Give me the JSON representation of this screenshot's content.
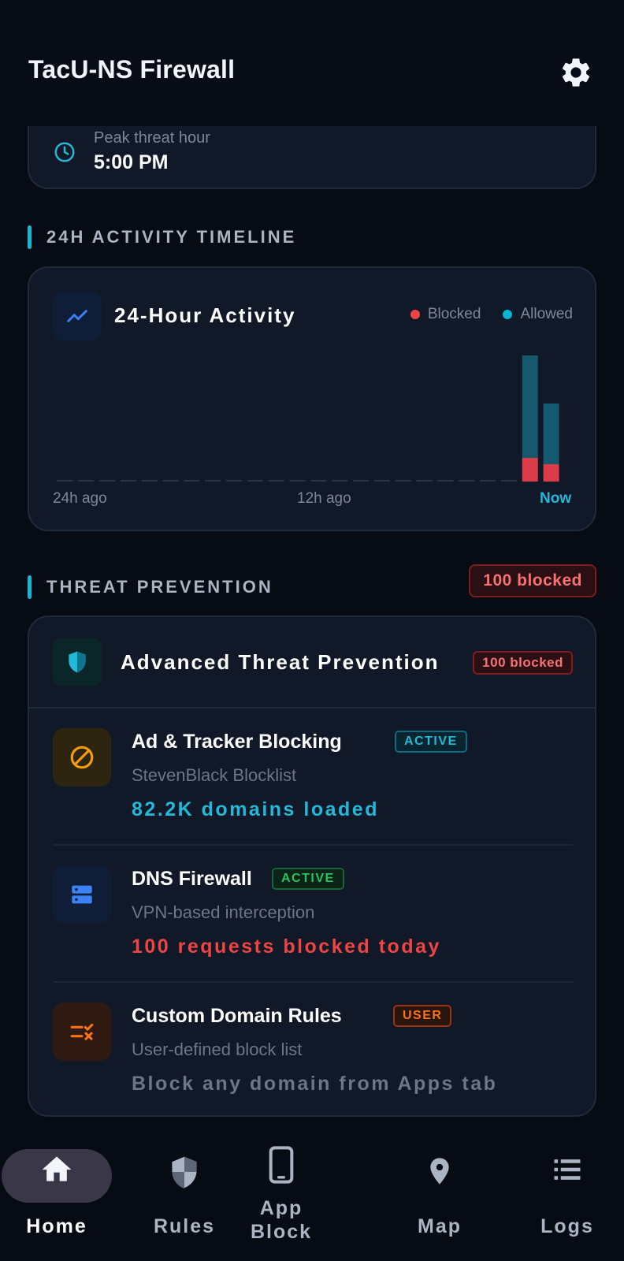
{
  "app": {
    "title": "TacU-NS Firewall"
  },
  "peak": {
    "label": "Peak threat hour",
    "value": "5:00 PM"
  },
  "timeline_section": {
    "title": "24H ACTIVITY TIMELINE"
  },
  "activity_chart": {
    "title": "24-Hour Activity",
    "legend": {
      "blocked": "Blocked",
      "allowed": "Allowed"
    },
    "x_labels": {
      "start": "24h ago",
      "mid": "12h ago",
      "end": "Now"
    },
    "colors": {
      "blocked": "#dc3c48",
      "allowed": "#15596e",
      "dash": "#2a3546"
    }
  },
  "chart_data": {
    "type": "bar",
    "stacked": true,
    "categories": [
      "-23h",
      "-22h",
      "-21h",
      "-20h",
      "-19h",
      "-18h",
      "-17h",
      "-16h",
      "-15h",
      "-14h",
      "-13h",
      "-12h",
      "-11h",
      "-10h",
      "-9h",
      "-8h",
      "-7h",
      "-6h",
      "-5h",
      "-4h",
      "-3h",
      "-2h",
      "-1h",
      "Now"
    ],
    "series": [
      {
        "name": "Blocked",
        "values": [
          0,
          0,
          0,
          0,
          0,
          0,
          0,
          0,
          0,
          0,
          0,
          0,
          0,
          0,
          0,
          0,
          0,
          0,
          0,
          0,
          0,
          0,
          30,
          22
        ]
      },
      {
        "name": "Allowed",
        "values": [
          0,
          0,
          0,
          0,
          0,
          0,
          0,
          0,
          0,
          0,
          0,
          0,
          0,
          0,
          0,
          0,
          0,
          0,
          0,
          0,
          0,
          0,
          130,
          77
        ]
      }
    ],
    "ylim": [
      0,
      160
    ],
    "grid": false
  },
  "threat_section": {
    "title": "THREAT PREVENTION",
    "badge": "100 blocked"
  },
  "threat_card": {
    "title": "Advanced Threat Prevention",
    "badge": "100 blocked",
    "features": [
      {
        "name": "Ad & Tracker Blocking",
        "tag": "ACTIVE",
        "sub": "StevenBlack Blocklist",
        "stat": "82.2K domains loaded",
        "icon": "block-icon"
      },
      {
        "name": "DNS Firewall",
        "tag": "ACTIVE",
        "sub": "VPN-based interception",
        "stat": "100 requests blocked today",
        "icon": "server-icon"
      },
      {
        "name": "Custom Domain Rules",
        "tag": "USER",
        "sub": "User-defined block list",
        "stat": "Block any domain from Apps tab",
        "icon": "rule-list-icon"
      }
    ]
  },
  "nav": {
    "items": [
      {
        "label": "Home",
        "icon": "home-icon",
        "selected": true
      },
      {
        "label": "Rules",
        "icon": "shield-icon"
      },
      {
        "label": "App\nBlock",
        "icon": "phone-icon"
      },
      {
        "label": "Map",
        "icon": "location-pin-icon"
      },
      {
        "label": "Logs",
        "icon": "list-icon"
      }
    ]
  }
}
